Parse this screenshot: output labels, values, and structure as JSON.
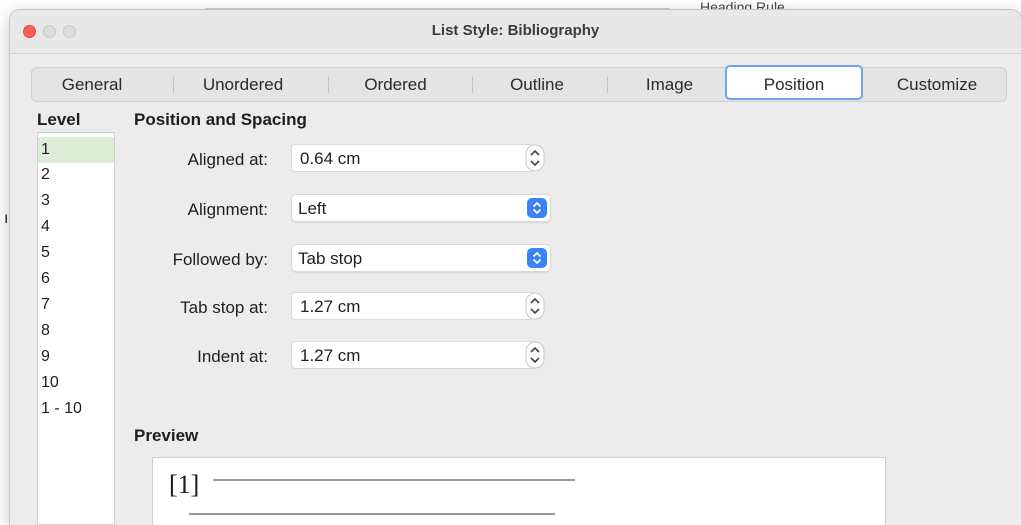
{
  "window": {
    "title": "List Style: Bibliography"
  },
  "background": {
    "partial_text": "Heading Rule"
  },
  "tabs": [
    {
      "label": "General"
    },
    {
      "label": "Unordered"
    },
    {
      "label": "Ordered"
    },
    {
      "label": "Outline"
    },
    {
      "label": "Image"
    },
    {
      "label": "Position",
      "active": true
    },
    {
      "label": "Customize"
    }
  ],
  "levels": {
    "heading": "Level",
    "items": [
      "1",
      "2",
      "3",
      "4",
      "5",
      "6",
      "7",
      "8",
      "9",
      "10",
      "1 - 10"
    ],
    "selected": "1"
  },
  "position_spacing": {
    "heading": "Position and Spacing",
    "aligned_at": {
      "label": "Aligned at:",
      "value": "0.64 cm"
    },
    "alignment": {
      "label": "Alignment:",
      "value": "Left"
    },
    "followed_by": {
      "label": "Followed by:",
      "value": "Tab stop"
    },
    "tab_stop_at": {
      "label": "Tab stop at:",
      "value": "1.27 cm"
    },
    "indent_at": {
      "label": "Indent at:",
      "value": "1.27 cm"
    }
  },
  "preview": {
    "heading": "Preview",
    "marker": "[1]"
  },
  "colors": {
    "accent": "#3b82f6",
    "tab_focus_ring": "#6fa2f5",
    "selected_level": "#dcefd6",
    "close_button": "#fe5f57"
  },
  "icons": [
    "close-icon",
    "minimize-icon",
    "zoom-icon",
    "stepper-icon",
    "select-arrows-icon"
  ]
}
